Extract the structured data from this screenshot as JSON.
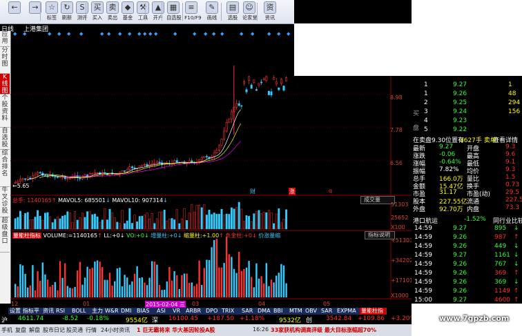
{
  "toolbar": {
    "buttons": [
      {
        "label": "",
        "icon": "back-icon"
      },
      {
        "label": "",
        "icon": "forward-icon"
      },
      {
        "label": "标签",
        "icon": "label-icon"
      },
      {
        "label": "刷新",
        "icon": "refresh-icon"
      },
      {
        "label": "测评",
        "icon": "evaluate-icon"
      },
      {
        "label": "买入",
        "icon": "buy-icon"
      },
      {
        "label": "卖出",
        "icon": "sell-icon"
      },
      {
        "label": "基金",
        "icon": "fund-icon"
      },
      {
        "label": "工具",
        "icon": "tool-icon"
      },
      {
        "label": "开户",
        "icon": "account-icon"
      },
      {
        "label": "自选股",
        "icon": "watchlist-icon"
      },
      {
        "label": "F10/F9",
        "icon": "f10-icon"
      },
      {
        "label": "画线",
        "icon": "draw-icon"
      },
      {
        "label": "选股",
        "icon": "stock-pick-icon"
      },
      {
        "label": "论家堂",
        "icon": "forum-icon"
      },
      {
        "label": "资讯",
        "icon": "news-icon"
      }
    ]
  },
  "header": {
    "period": "日线",
    "stock_name": "上港集团"
  },
  "left_tabs": [
    {
      "label": "应用",
      "active": false
    },
    {
      "label": "分时图",
      "active": false
    },
    {
      "label": "K线图",
      "active": true
    },
    {
      "label": "个股资料",
      "active": false
    },
    {
      "label": "自选股",
      "active": false
    },
    {
      "label": "综合排名",
      "active": false
    },
    {
      "label": "牛叉诊股",
      "active": false
    },
    {
      "label": "超级盘口",
      "active": false
    }
  ],
  "price_axis": {
    "labels": [
      "8.98",
      "7.78",
      "6.56"
    ],
    "low_mark": "←5.65"
  },
  "event_marks": [
    "财",
    "涨",
    "q"
  ],
  "volume_panel": {
    "label_total": "总手: 1140165",
    "mavol5": "MAVOL5: 685501",
    "mavol10": "MAVOL10: 907314",
    "button": "成交量",
    "axis": [
      "51303",
      "25652",
      "X100"
    ]
  },
  "indicator_panel": {
    "title": "量能柱指标",
    "volume": "VOLUME:=1140165",
    "ll": "LL:+0",
    "vo": "VO:+0",
    "up": "增量柱:+0",
    "down": "缩量柱:+1.00",
    "neg": "负金柱:+0",
    "price": "价涨量缩",
    "button": "指标说明",
    "axis": [
      "+513035",
      "+342023",
      "+171012",
      "X1000"
    ]
  },
  "time_axis": {
    "labels": [
      "12",
      "01",
      "2015-02-04 三",
      "03",
      "04",
      "05"
    ]
  },
  "bottom_tabs": [
    "设置",
    "指标平台",
    "资讯",
    "RSI",
    "BOLL",
    "主力",
    "W&R",
    "DMI",
    "BIAS",
    "ASI",
    "VR",
    "ARBR",
    "DPO",
    "TRIX",
    "SAR",
    "DMA",
    "BBI",
    "MTM",
    "OBV",
    "SAR",
    "EXPMA",
    "量能柱指标"
  ],
  "status_bar": {
    "sh_label": "沪",
    "sh_index": "4611.74",
    "sh_change": "-8.52",
    "sh_pct": "-0.18%",
    "sh_amount": "9554亿",
    "sz_label": "深",
    "sz_index": "16100.45",
    "sz_change": "+187.50",
    "sz_pct": "+1.18%",
    "sz_amount": "9532亿",
    "cy_label": "创",
    "cy_index": "3542.84",
    "cy_change": "+109.86",
    "cy_pct": "+3.20%"
  },
  "status_bar2": {
    "items": [
      "手机",
      "复盘",
      "解盘",
      "股市日记",
      "股灵通",
      "行情",
      "24小时资讯"
    ],
    "ticker": "1 巨无霸将来 华大基因轮投A股",
    "time": "16:26",
    "ticker2": "33家获机构调高评级 最大目标涨幅超70%"
  },
  "quote_panel": {
    "bid_label": "买",
    "bid_label2": "盘",
    "bids": [
      {
        "n": "1",
        "price": "9.27",
        "vol": "1"
      },
      {
        "n": "1",
        "price": "9.26",
        "vol": "48"
      },
      {
        "n": "2",
        "price": "9.25",
        "vol": "294"
      },
      {
        "n": "3",
        "price": "9.24",
        "vol": "156"
      },
      {
        "n": "4",
        "price": "9.23",
        "vol": ""
      },
      {
        "n": "5",
        "price": "9.22",
        "vol": ""
      }
    ],
    "info_line": "在卖盘9.30位置有",
    "info_line2": "3627手 卖单!",
    "info_link": "查看详情",
    "stats": [
      {
        "k": "最新",
        "v": "9.27",
        "k2": "开盘",
        "v2": "9.3"
      },
      {
        "k": "涨跌",
        "v": "-0.06",
        "k2": "最高",
        "v2": "9.6"
      },
      {
        "k": "涨幅",
        "v": "-0.64%",
        "k2": "最低",
        "v2": "9.1"
      },
      {
        "k": "振幅",
        "v": "7.82%",
        "k2": "均价",
        "v2": "9.3"
      },
      {
        "k": "总手",
        "v": "166.0万",
        "k2": "量比",
        "v2": "1.5"
      },
      {
        "k": "金额",
        "v": "15.47亿",
        "k2": "换手",
        "v2": "0.73"
      },
      {
        "k": "市盈",
        "v": "31.17",
        "k2": "市盈(动)",
        "v2": "29.5"
      },
      {
        "k": "股本",
        "v": "227.55亿",
        "k2": "流通",
        "v2": "227.55"
      },
      {
        "k": "外盘",
        "v": "92.70万",
        "k2": "内盘",
        "v2": "73.3"
      }
    ],
    "sector": "港口航运",
    "sector_pct": "-1.52%",
    "compare": "同行业比较",
    "ticks": [
      {
        "t": "14:59",
        "p": "9.27",
        "v": "895",
        "d": "down"
      },
      {
        "t": "14:59",
        "p": "9.26",
        "v": "987",
        "d": "up"
      },
      {
        "t": "14:59",
        "p": "9.26",
        "v": "449",
        "d": "down"
      },
      {
        "t": "14:59",
        "p": "9.27",
        "v": "1161",
        "d": "down"
      },
      {
        "t": "14:59",
        "p": "9.26",
        "v": "767",
        "d": "down"
      },
      {
        "t": "14:59",
        "p": "9.26",
        "v": "369",
        "d": "up"
      },
      {
        "t": "14:59",
        "p": "9.26",
        "v": "369",
        "d": "down"
      },
      {
        "t": "14:59",
        "p": "9.26",
        "v": "1149",
        "d": "up"
      },
      {
        "t": "15:00",
        "p": "9.27",
        "v": "4600",
        "d": "up"
      }
    ]
  },
  "colors": {
    "up": "#ff3030",
    "down": "#33ccff",
    "bg": "#000000",
    "grid": "#5a0000"
  },
  "watermark": "www.7gpzb.com"
}
